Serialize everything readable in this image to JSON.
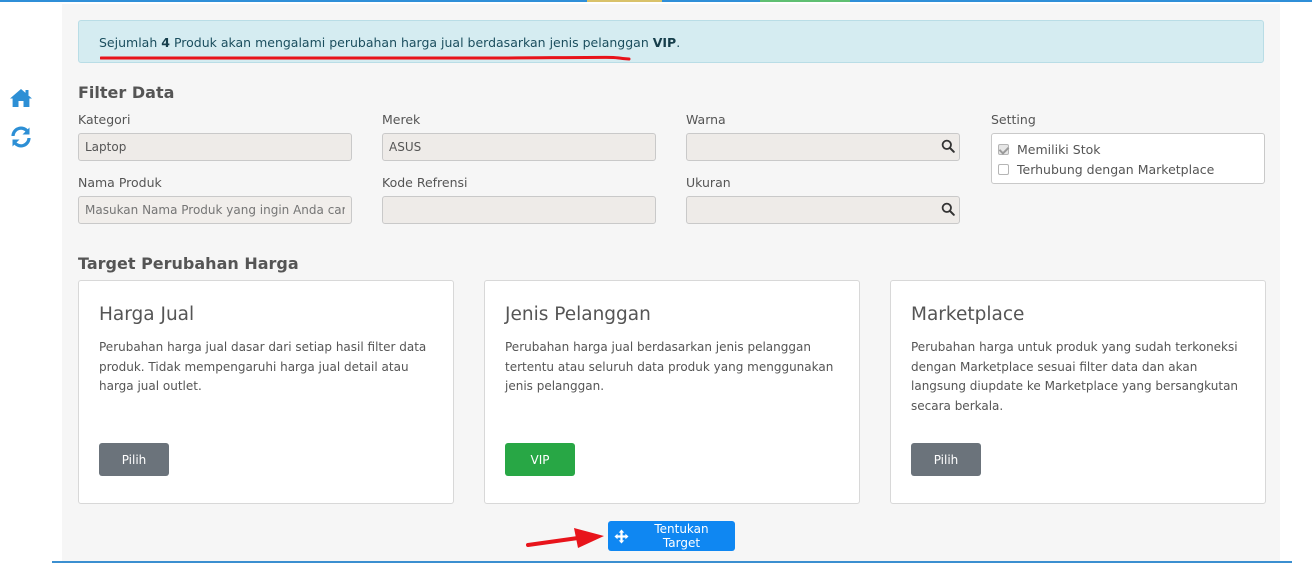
{
  "alert": {
    "prefix": "Sejumlah",
    "count": "4",
    "middle": "Produk akan mengalami perubahan harga jual berdasarkan jenis pelanggan",
    "customer_type": "VIP",
    "suffix": "."
  },
  "filter": {
    "title": "Filter Data",
    "kategori": {
      "label": "Kategori",
      "value": "Laptop"
    },
    "merek": {
      "label": "Merek",
      "value": "ASUS"
    },
    "warna": {
      "label": "Warna",
      "value": ""
    },
    "nama_produk": {
      "label": "Nama Produk",
      "placeholder": "Masukan Nama Produk yang ingin Anda cari"
    },
    "kode_referensi": {
      "label": "Kode Refrensi",
      "value": ""
    },
    "ukuran": {
      "label": "Ukuran",
      "value": ""
    },
    "setting": {
      "label": "Setting",
      "options": [
        {
          "label": "Memiliki Stok",
          "checked": true
        },
        {
          "label": "Terhubung dengan Marketplace",
          "checked": false
        }
      ]
    }
  },
  "target": {
    "title": "Target Perubahan Harga",
    "cards": [
      {
        "title": "Harga Jual",
        "description": "Perubahan harga jual dasar dari setiap hasil filter data produk. Tidak mempengaruhi harga jual detail atau harga jual outlet.",
        "button": "Pilih"
      },
      {
        "title": "Jenis Pelanggan",
        "description": "Perubahan harga jual berdasarkan jenis pelanggan tertentu atau seluruh data produk yang menggunakan jenis pelanggan.",
        "button": "VIP"
      },
      {
        "title": "Marketplace",
        "description": "Perubahan harga untuk produk yang sudah terkoneksi dengan Marketplace sesuai filter data dan akan langsung diupdate ke Marketplace yang bersangkutan secara berkala.",
        "button": "Pilih"
      }
    ]
  },
  "actions": {
    "submit": "Tentukan Target"
  },
  "colors": {
    "accent": "#0f87f2",
    "success": "#28a745",
    "secondary": "#6b737b",
    "alert_bg": "#d5ecf1",
    "annotation": "#e8141b"
  },
  "icons": {
    "home": "home-icon",
    "refresh": "refresh-icon",
    "search": "search-icon",
    "target": "crosshair-icon",
    "annotation": "red-arrow-icon"
  }
}
